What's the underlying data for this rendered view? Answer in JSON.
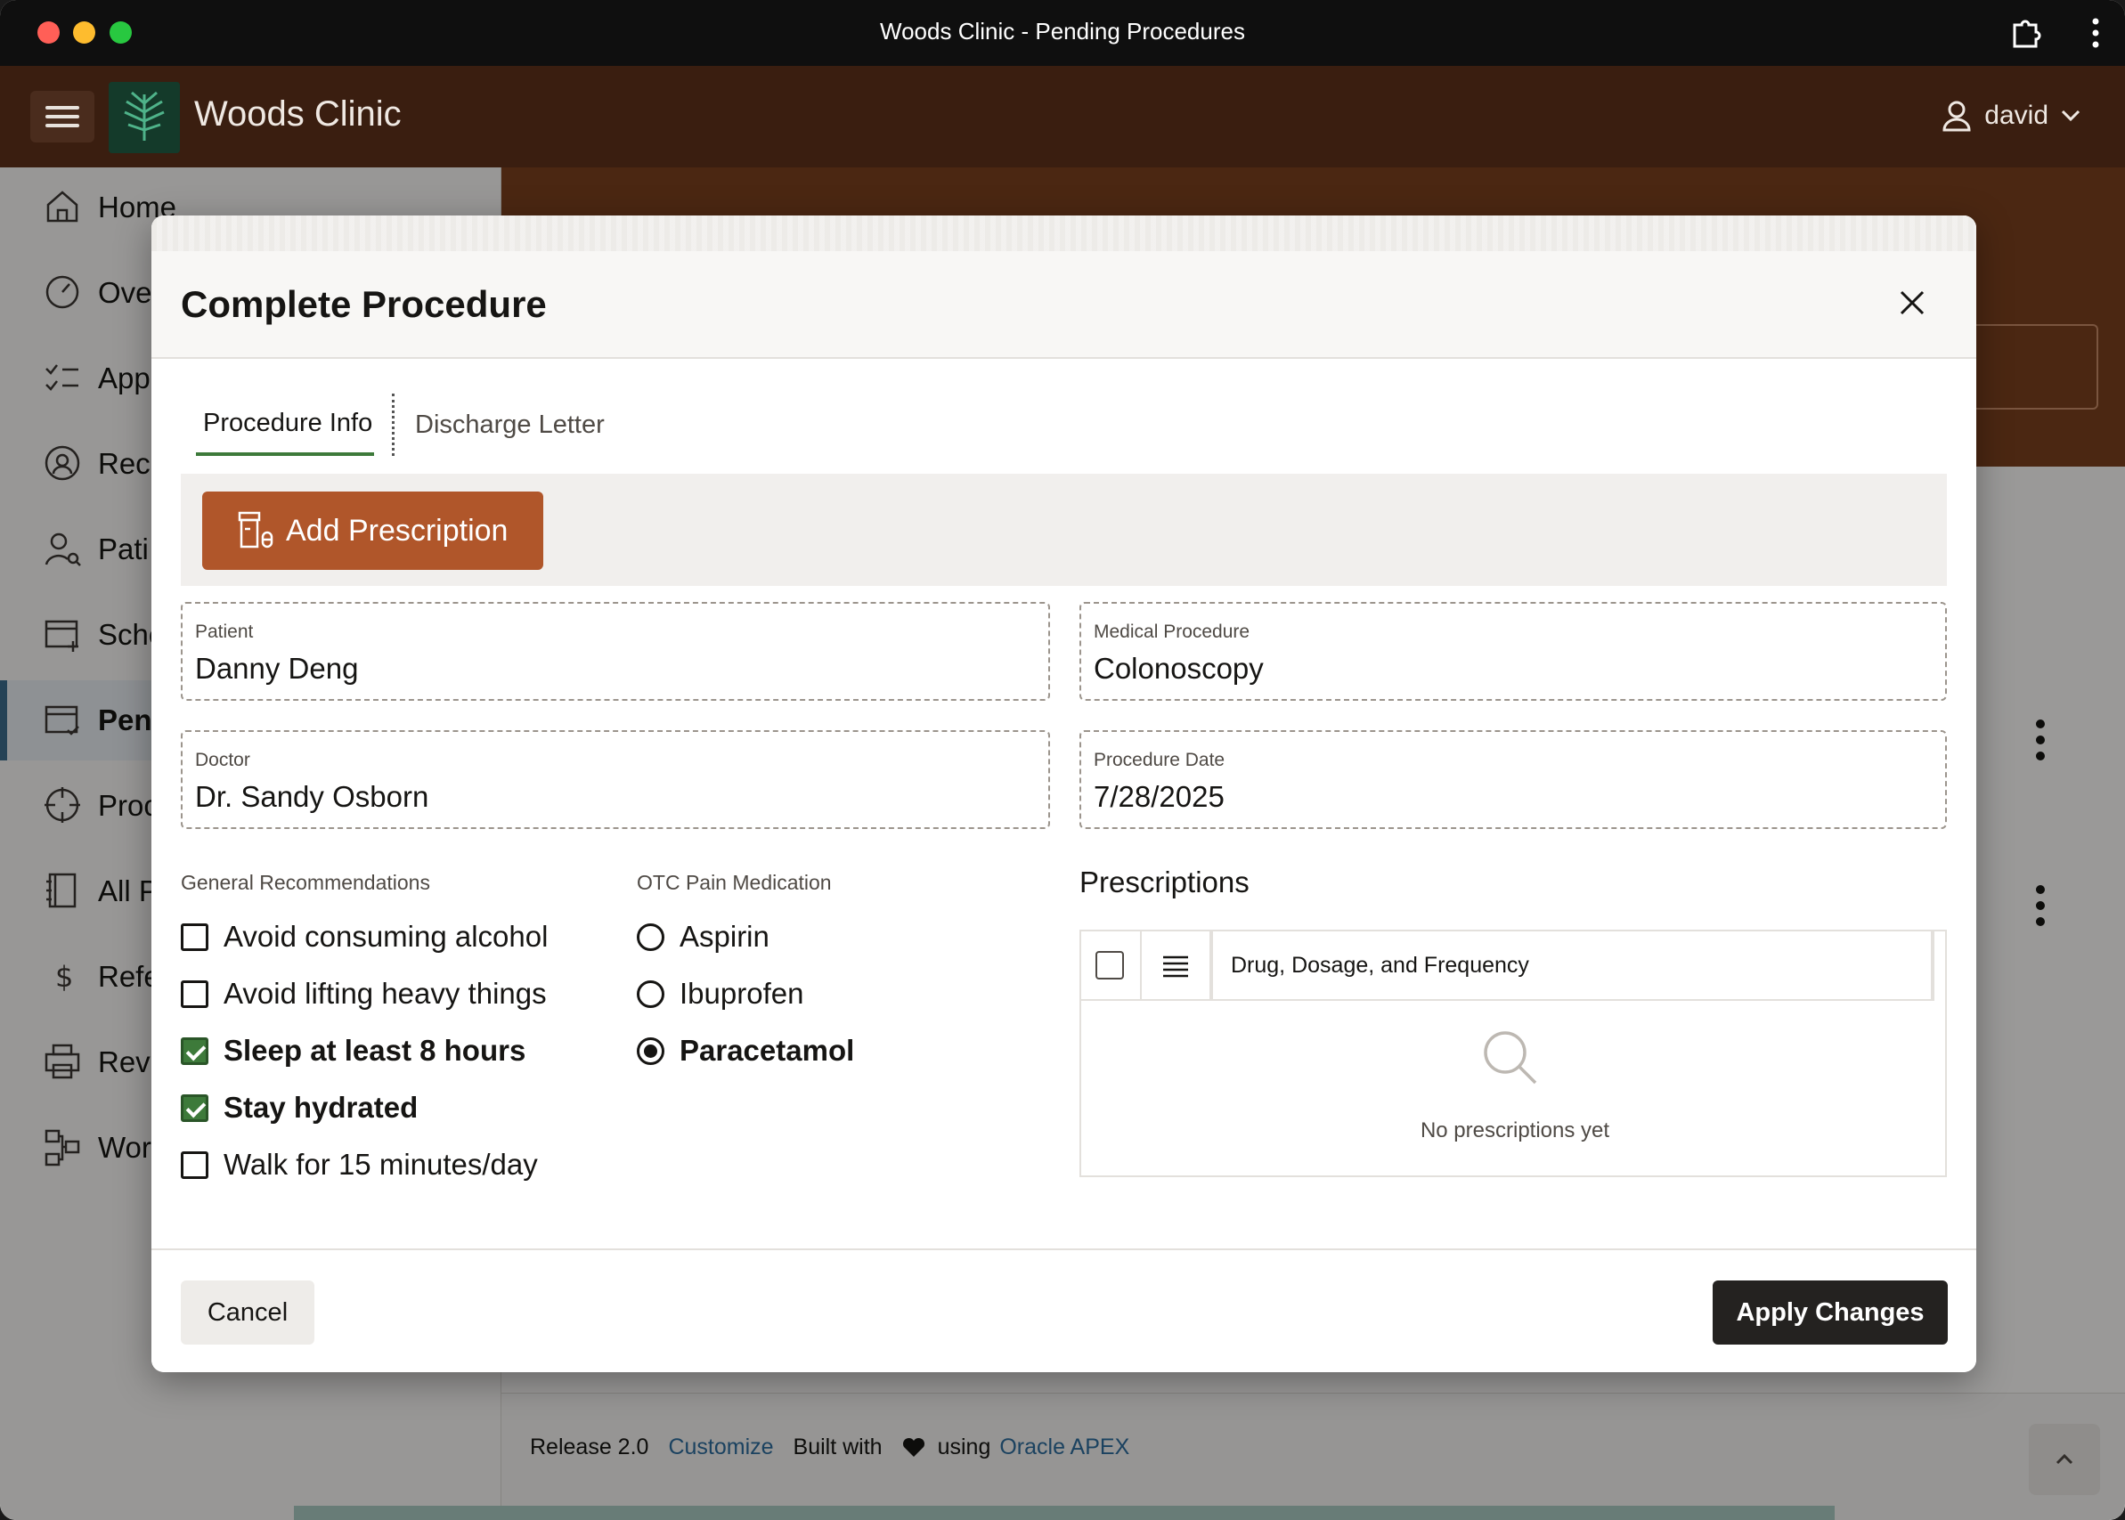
{
  "window": {
    "title": "Woods Clinic - Pending Procedures"
  },
  "header": {
    "brand": "Woods Clinic",
    "user": "david"
  },
  "sidebar": {
    "items": [
      {
        "label": "Home",
        "icon": "home-icon"
      },
      {
        "label": "Ove",
        "icon": "dashboard-icon"
      },
      {
        "label": "App",
        "icon": "checklist-icon"
      },
      {
        "label": "Rece",
        "icon": "reception-icon"
      },
      {
        "label": "Pati",
        "icon": "patient-icon"
      },
      {
        "label": "Sche",
        "icon": "calendar-plus-icon"
      },
      {
        "label": "Pen",
        "icon": "calendar-check-icon",
        "active": true
      },
      {
        "label": "Proc",
        "icon": "crosshair-icon"
      },
      {
        "label": "All P",
        "icon": "notebook-icon"
      },
      {
        "label": "Refe",
        "icon": "dollar-icon"
      },
      {
        "label": "Revi",
        "icon": "printer-icon"
      },
      {
        "label": "Wor",
        "icon": "workflow-icon"
      }
    ]
  },
  "footer": {
    "release": "Release 2.0",
    "customize": "Customize",
    "built_with": "Built with",
    "using": "using",
    "apex": "Oracle APEX"
  },
  "dialog": {
    "title": "Complete Procedure",
    "tabs": [
      "Procedure Info",
      "Discharge Letter"
    ],
    "add_prescription": "Add Prescription",
    "fields": {
      "patient": {
        "label": "Patient",
        "value": "Danny Deng"
      },
      "medical_procedure": {
        "label": "Medical Procedure",
        "value": "Colonoscopy"
      },
      "doctor": {
        "label": "Doctor",
        "value": "Dr. Sandy Osborn"
      },
      "procedure_date": {
        "label": "Procedure Date",
        "value": "7/28/2025"
      }
    },
    "general_recommendations": {
      "label": "General Recommendations",
      "options": [
        {
          "label": "Avoid consuming alcohol",
          "checked": false
        },
        {
          "label": "Avoid lifting heavy things",
          "checked": false
        },
        {
          "label": "Sleep at least 8 hours",
          "checked": true
        },
        {
          "label": "Stay hydrated",
          "checked": true
        },
        {
          "label": "Walk for 15 minutes/day",
          "checked": false
        }
      ]
    },
    "otc_pain_medication": {
      "label": "OTC Pain Medication",
      "options": [
        {
          "label": "Aspirin",
          "selected": false
        },
        {
          "label": "Ibuprofen",
          "selected": false
        },
        {
          "label": "Paracetamol",
          "selected": true
        }
      ]
    },
    "prescriptions": {
      "title": "Prescriptions",
      "column": "Drug, Dosage, and Frequency",
      "empty_text": "No prescriptions yet"
    },
    "cancel": "Cancel",
    "apply": "Apply Changes"
  },
  "colors": {
    "header_bg": "#3a1e10",
    "accent_button": "#b0562a",
    "tab_underline": "#3d7a3a",
    "checkbox_checked": "#3d7a3a",
    "primary_button": "#242220"
  }
}
